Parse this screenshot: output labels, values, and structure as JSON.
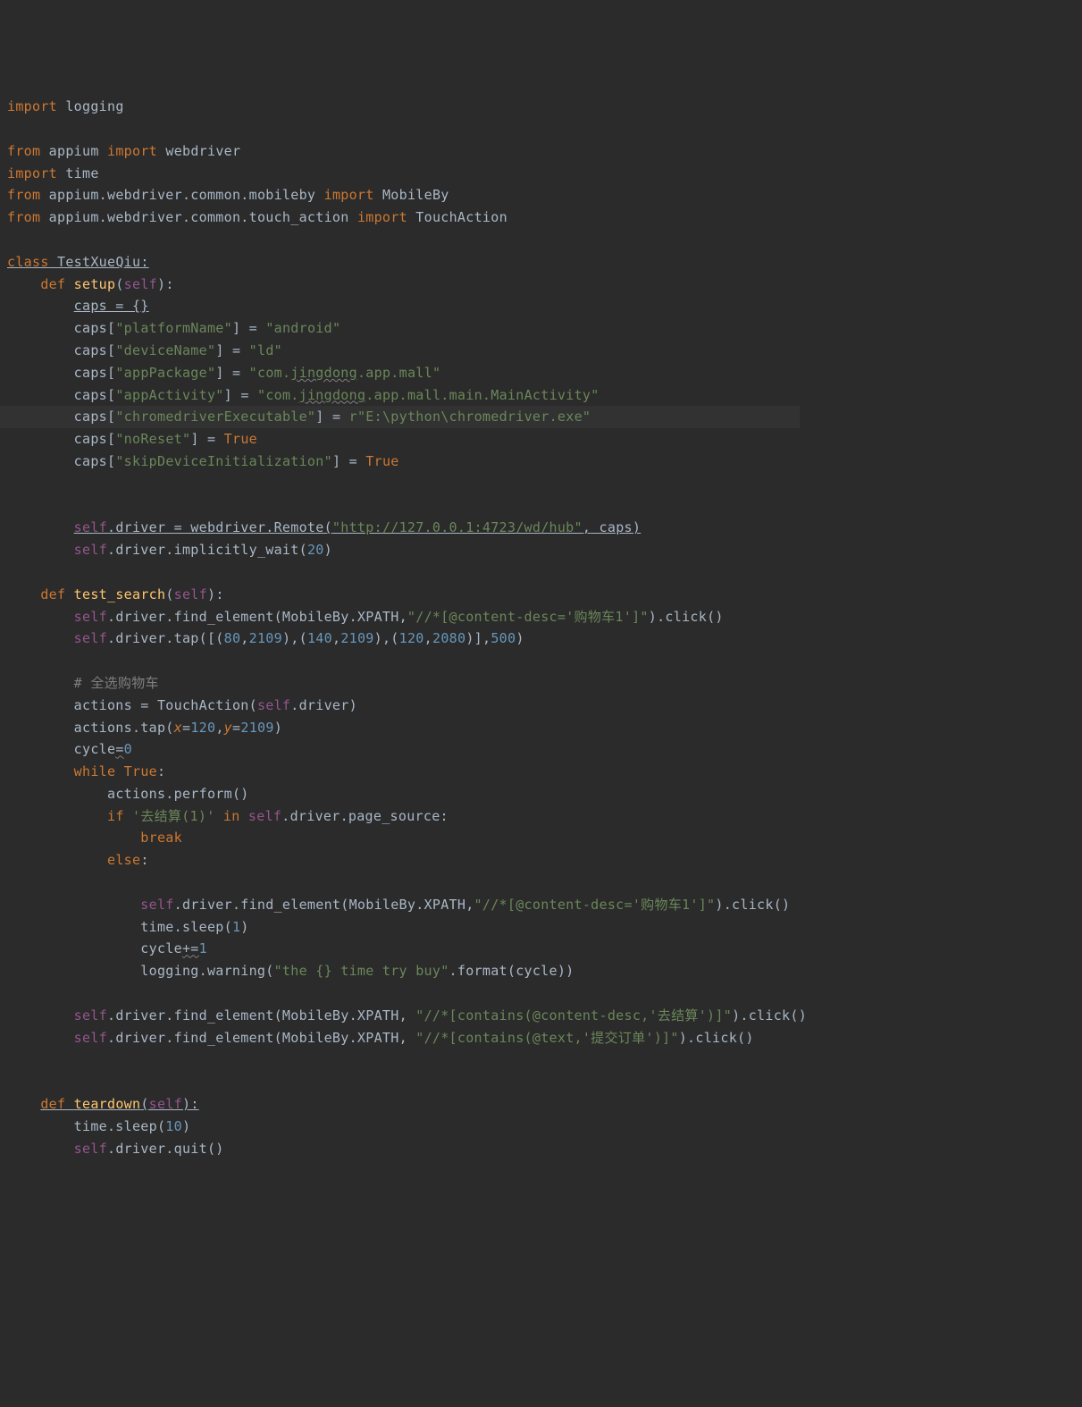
{
  "imports": {
    "l1": {
      "kw": "import",
      "mod": "logging"
    },
    "l3": {
      "kw1": "from",
      "mod": "appium",
      "kw2": "import",
      "name": "webdriver"
    },
    "l4": {
      "kw": "import",
      "mod": "time"
    },
    "l5": {
      "kw1": "from",
      "mod": "appium.webdriver.common.mobileby",
      "kw2": "import",
      "name": "MobileBy"
    },
    "l6": {
      "kw1": "from",
      "mod": "appium.webdriver.common.touch_action",
      "kw2": "import",
      "name": "TouchAction"
    }
  },
  "class_def": {
    "kw": "class",
    "name": "TestXueQiu",
    "colon": ":"
  },
  "setup": {
    "def": "def",
    "name": "setup",
    "self": "self",
    "caps_init": "caps = {}",
    "caps": "caps",
    "k_platform": "\"platformName\"",
    "v_platform": "\"android\"",
    "k_device": "\"deviceName\"",
    "v_device": "\"ld\"",
    "k_pkg": "\"appPackage\"",
    "v_pkg_a": "\"com.",
    "v_pkg_b": "jingdong",
    "v_pkg_c": ".app.mall\"",
    "k_act": "\"appActivity\"",
    "v_act_a": "\"com.",
    "v_act_b": "jingdong",
    "v_act_c": ".app.mall.main.MainActivity\"",
    "k_chrome": "\"chromedriverExecutable\"",
    "v_chrome_pre": "r",
    "v_chrome": "\"E:\\python\\chromedriver.exe\"",
    "k_noreset": "\"noReset\"",
    "v_true": "True",
    "k_skip": "\"skipDeviceInitialization\"",
    "eq": " = ",
    "driver_line_label": "self.driver = webdriver.Remote(",
    "remote_url": "\"http://127.0.0.1:4723/wd/hub\"",
    "caps_arg": " caps)",
    "implicit": ".driver.implicitly_wait(",
    "implicit_n": "20"
  },
  "test": {
    "def": "def",
    "name": "test_search",
    "self": "self",
    "find_elem": ".driver.find_element(MobileBy.XPATH",
    "xp1": "\"//*[@content-desc='购物车1']\"",
    "click": ").click()",
    "tap_prefix": ".driver.tap([(",
    "n80": "80",
    "n2109": "2109",
    "n140": "140",
    "n120": "120",
    "n2080": "2080",
    "n500": "500",
    "comment1": "# 全选购物车",
    "actions_assign": "actions = TouchAction(",
    "driver_sfx": ".driver)",
    "actions_tap": "actions.tap(",
    "x_kw": "x",
    "y_kw": "y",
    "eq": "=",
    "cycle_init_a": "cycle",
    "cycle_init_b": "=",
    "cycle_init_c": "0",
    "while_kw": "while",
    "true_kw": "True",
    "colon": ":",
    "perform": "actions.perform()",
    "if_kw": "if",
    "in_kw": "in",
    "page_src": ".driver.page_source:",
    "cond_str": "'去结算(1)'",
    "break_kw": "break",
    "else_kw": "else",
    "sleep": "time.sleep(",
    "n1": "1",
    "cycle_inc_a": "cycle",
    "cycle_inc_b": "+=",
    "cycle_inc_c": "1",
    "log_pre": "logging.warning(",
    "log_str": "\"the {} time try buy\"",
    "log_sfx": ".format(cycle))",
    "xp2": "\"//*[contains(@content-desc,'去结算')]\"",
    "xp3": "\"//*[contains(@text,'提交订单')]\""
  },
  "teardown": {
    "def": "def",
    "name": "teardown",
    "self": "self",
    "sleep": "time.sleep(",
    "n10": "10",
    "quit": ".driver.quit()"
  }
}
